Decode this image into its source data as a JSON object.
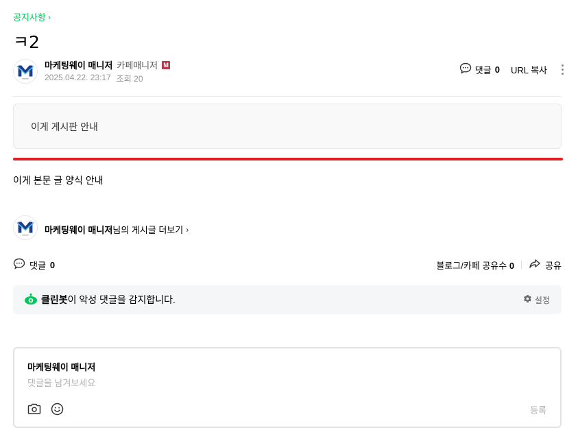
{
  "header": {
    "board_name": "공지사항",
    "title": "ㅋ2"
  },
  "author": {
    "name": "마케팅웨이 매니저",
    "role": "카페매니저",
    "badge": "M",
    "date": "2025.04.22. 23:17",
    "views_label": "조회 20"
  },
  "top_actions": {
    "comment_label": "댓글",
    "comment_count": "0",
    "url_copy_label": "URL 복사"
  },
  "guide_box": {
    "text": "이게 게시판 안내"
  },
  "content": {
    "body_text": "이게 본문 글 양식 안내"
  },
  "more_posts": {
    "author": "마케팅웨이 매니저",
    "suffix": "님의 게시글 더보기"
  },
  "bottom_actions": {
    "comment_label": "댓글",
    "comment_count": "0",
    "share_count_label": "블로그/카페 공유수",
    "share_count": "0",
    "share_label": "공유"
  },
  "cleanbot": {
    "name": "클린봇",
    "message": "이 악성 댓글을 감지합니다.",
    "settings_label": "설정"
  },
  "comment_form": {
    "writer": "마케팅웨이 매니저",
    "placeholder": "댓글을 남겨보세요",
    "submit_label": "등록"
  },
  "colors": {
    "accent_green": "#03c75a",
    "notice_red": "#e02025",
    "manager_badge": "#b53a4b"
  }
}
